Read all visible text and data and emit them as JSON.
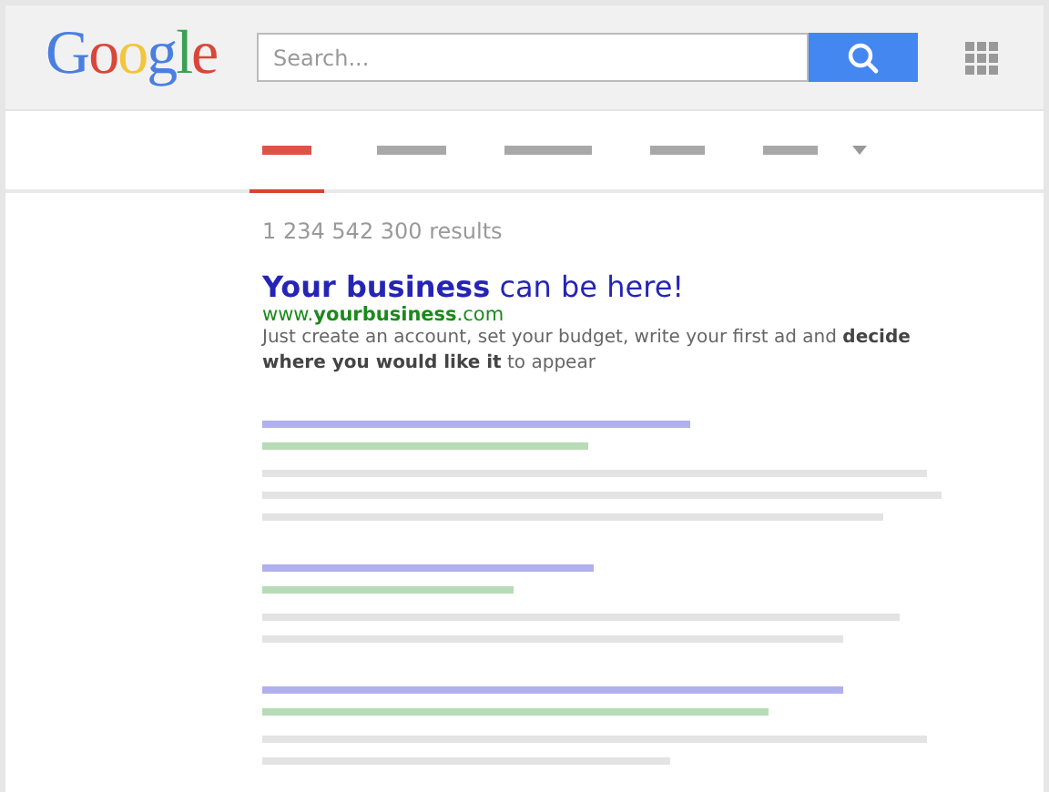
{
  "logo": [
    {
      "char": "G",
      "color": "#4a7fe0"
    },
    {
      "char": "o",
      "color": "#d8473a"
    },
    {
      "char": "o",
      "color": "#f2c53d"
    },
    {
      "char": "g",
      "color": "#4a7fe0"
    },
    {
      "char": "l",
      "color": "#3aa154"
    },
    {
      "char": "e",
      "color": "#d8473a"
    }
  ],
  "search": {
    "placeholder": "Search..."
  },
  "tabs": [
    {
      "selected": true
    },
    {
      "selected": false
    },
    {
      "selected": false
    },
    {
      "selected": false
    },
    {
      "selected": false
    }
  ],
  "results_count": "1 234 542 300 results",
  "ad": {
    "title": "**Your business** can be here!",
    "url": "www.**yourbusiness**.com",
    "snippet": "Just create an account, set your budget, write your first ad and **decide where you would like it** to appear"
  },
  "placeholder_results": [
    {
      "kind": "skeleton"
    },
    {
      "kind": "skeleton"
    },
    {
      "kind": "skeleton"
    }
  ]
}
